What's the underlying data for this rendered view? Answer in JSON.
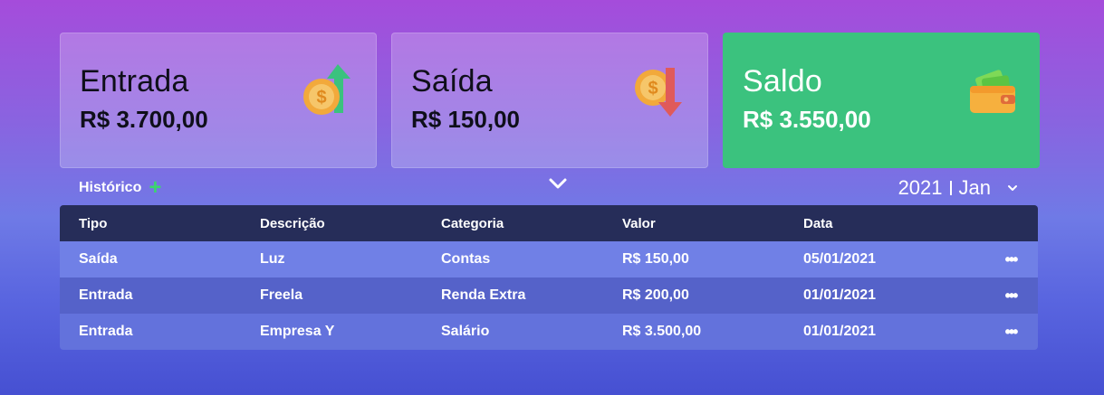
{
  "cards": [
    {
      "title": "Entrada",
      "amount": "R$ 3.700,00",
      "icon": "coin-arrow-up-icon"
    },
    {
      "title": "Saída",
      "amount": "R$ 150,00",
      "icon": "coin-arrow-down-icon"
    },
    {
      "title": "Saldo",
      "amount": "R$ 3.550,00",
      "icon": "wallet-icon"
    }
  ],
  "history": {
    "label": "Histórico",
    "add_icon": "plus-icon"
  },
  "period": {
    "year": "2021",
    "month": "Jan"
  },
  "table": {
    "headers": [
      "Tipo",
      "Descrição",
      "Categoria",
      "Valor",
      "Data"
    ],
    "rows": [
      [
        "Saída",
        "Luz",
        "Contas",
        "R$ 150,00",
        "05/01/2021"
      ],
      [
        "Entrada",
        "Freela",
        "Renda Extra",
        "R$ 200,00",
        "01/01/2021"
      ],
      [
        "Entrada",
        "Empresa Y",
        "Salário",
        "R$ 3.500,00",
        "01/01/2021"
      ]
    ],
    "row_action": "•••"
  },
  "colors": {
    "income": "#3bc27e",
    "expense": "#e05a5a",
    "header": "#262d59"
  }
}
